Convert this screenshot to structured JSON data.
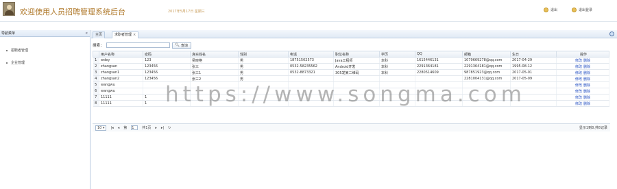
{
  "header": {
    "title": "欢迎使用人员招聘管理系统后台",
    "date_text": "2017年5月17日 星期三",
    "buttons": [
      {
        "label": "退出"
      },
      {
        "label": "退出登录"
      }
    ]
  },
  "left_panel": {
    "title": "导航菜单",
    "items": [
      {
        "label": "招聘者管理"
      },
      {
        "label": "企业管理"
      }
    ]
  },
  "tabs": [
    {
      "label": "主页"
    },
    {
      "label": "求职者管理"
    }
  ],
  "search": {
    "label": "搜索：",
    "value": "",
    "button": "查询"
  },
  "table": {
    "columns": [
      "用户名称",
      "密码",
      "真实姓名",
      "性别",
      "电话",
      "职位名称",
      "学历",
      "QQ",
      "邮箱",
      "生日",
      "操作"
    ],
    "rows": [
      {
        "n": "1",
        "c": [
          "wdey",
          "123",
          "吴晓艳",
          "男",
          "18751502573",
          "Java工程师",
          "本科",
          "1615446131",
          "1079669278@qq.com",
          "2017-04-29"
        ]
      },
      {
        "n": "2",
        "c": [
          "zhangsan",
          "123456",
          "张三",
          "男",
          "0532-58235562",
          "Android开发",
          "本科",
          "2291364181",
          "2291364181@qq.com",
          "1995-08-12"
        ]
      },
      {
        "n": "3",
        "c": [
          "zhangsan1",
          "123456",
          "张三1",
          "男",
          "0532-8873321",
          "305发某二维码",
          "本科",
          "2280514609",
          "987851923@qq.com",
          "2017-05-01"
        ]
      },
      {
        "n": "4",
        "c": [
          "zhangsan2",
          "123456",
          "张三2",
          "男",
          "",
          "",
          "",
          "",
          "2281004131@qq.com",
          "2017-05-09"
        ]
      },
      {
        "n": "5",
        "c": [
          "wangwu",
          "",
          "",
          "",
          "",
          "",
          "",
          "",
          "",
          ""
        ]
      },
      {
        "n": "6",
        "c": [
          "wangwu",
          "",
          "",
          "",
          "",
          "",
          "",
          "",
          "",
          ""
        ]
      },
      {
        "n": "7",
        "c": [
          "11111",
          "1",
          "",
          "",
          "",
          "",
          "",
          "",
          "",
          ""
        ]
      },
      {
        "n": "8",
        "c": [
          "11111",
          "1",
          "",
          "",
          "",
          "",
          "",
          "",
          "",
          ""
        ]
      }
    ],
    "actions": [
      "修改",
      "删除"
    ]
  },
  "pager": {
    "page_size": "10",
    "page_label": "第",
    "page_value": "1",
    "total_pages": "共1页",
    "info": "显示1到8,共8记录"
  },
  "watermark": "https://www.songma.com",
  "colors": {
    "title": "#b07a2c",
    "link": "#1f4cc0",
    "panel_border": "#b9cbe0"
  },
  "icons": {
    "header_buttons": "coin-icon",
    "tab_tool": "gear-icon"
  }
}
